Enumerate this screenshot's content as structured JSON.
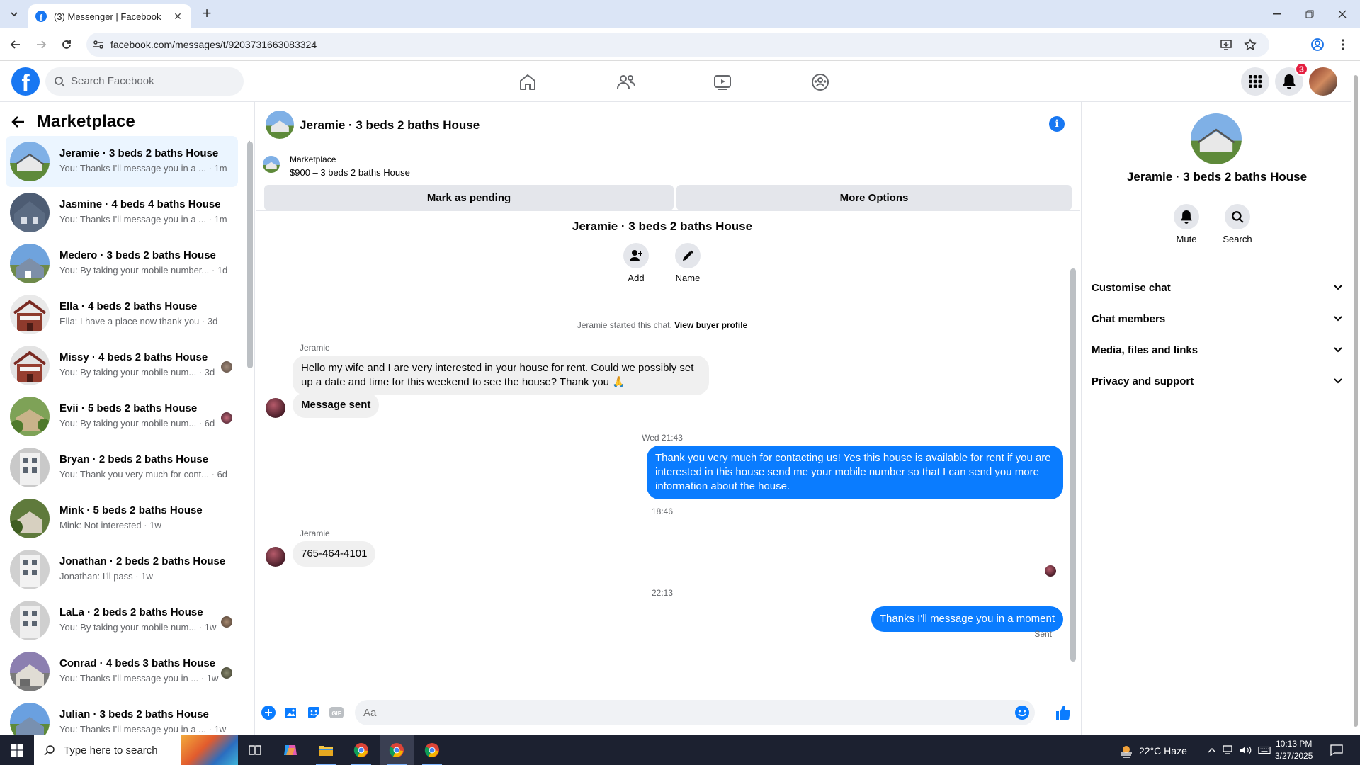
{
  "browser": {
    "tab_title": "(3) Messenger | Facebook",
    "url": "facebook.com/messages/t/9203731663083324"
  },
  "fb": {
    "search_placeholder": "Search Facebook",
    "notification_count": "3",
    "brand_color": "#1877f2"
  },
  "sidebar": {
    "title": "Marketplace",
    "conversations": [
      {
        "name": "Jeramie · 3 beds 2 baths House",
        "preview": "You: Thanks I'll message you in a ...",
        "time": "· 1m",
        "active": true
      },
      {
        "name": "Jasmine · 4 beds 4 baths House",
        "preview": "You: Thanks I'll message you in a ...",
        "time": "· 1m"
      },
      {
        "name": "Medero · 3 beds 2 baths House",
        "preview": "You: By taking your mobile number...",
        "time": "· 1d"
      },
      {
        "name": "Ella · 4 beds 2 baths House",
        "preview": "Ella: I have a place now thank you",
        "time": "· 3d"
      },
      {
        "name": "Missy · 4 beds 2 baths House",
        "preview": "You: By taking your mobile num...",
        "time": "· 3d"
      },
      {
        "name": "Evii · 5 beds 2 baths House",
        "preview": "You: By taking your mobile num...",
        "time": "· 6d"
      },
      {
        "name": "Bryan · 2 beds 2 baths House",
        "preview": "You: Thank you very much for cont...",
        "time": "· 6d"
      },
      {
        "name": "Mink · 5 beds 2 baths House",
        "preview": "Mink: Not interested",
        "time": "· 1w"
      },
      {
        "name": "Jonathan · 2 beds 2 baths House",
        "preview": "Jonathan: I'll pass",
        "time": "· 1w"
      },
      {
        "name": "LaLa · 2 beds 2 baths House",
        "preview": "You: By taking your mobile num...",
        "time": "· 1w"
      },
      {
        "name": "Conrad · 4 beds 3 baths House",
        "preview": "You: Thanks I'll message you in ...",
        "time": "· 1w"
      },
      {
        "name": "Julian · 3 beds 2 baths House",
        "preview": "You: Thanks I'll message you in a ...",
        "time": "· 1w"
      }
    ]
  },
  "chat": {
    "title": "Jeramie · 3 beds 2 baths House",
    "marketplace_label": "Marketplace",
    "listing": "$900 – 3 beds 2 baths House",
    "mark_pending": "Mark as pending",
    "more_options": "More Options",
    "intro_title": "Jeramie · 3 beds 2 baths House",
    "add_label": "Add",
    "name_label": "Name",
    "started_note": "Jeramie started this chat.",
    "view_profile": "View buyer profile",
    "messages": [
      {
        "sender": "Jeramie",
        "text": "Hello my wife and I are very interested in your house for rent. Could we possibly set up a date and time for this weekend to see the house? Thank you 🙏"
      },
      {
        "text": "Message sent"
      },
      {
        "time": "Wed 21:43"
      },
      {
        "text": "Thank you very much for contacting us! Yes this house is available for rent if you are interested in this house send me your mobile number so that I can send you more information about the house."
      },
      {
        "time": "18:46"
      },
      {
        "sender": "Jeramie",
        "text": "765-464-4101"
      },
      {
        "time": "22:13"
      },
      {
        "text": "Thanks I'll message you in a moment"
      }
    ],
    "sent_status": "Sent",
    "composer_placeholder": "Aa"
  },
  "rpanel": {
    "name": "Jeramie · 3 beds 2 baths House",
    "mute": "Mute",
    "search": "Search",
    "sections": [
      "Customise chat",
      "Chat members",
      "Media, files and links",
      "Privacy and support"
    ]
  },
  "taskbar": {
    "search_placeholder": "Type here to search",
    "weather": "22°C  Haze",
    "time": "10:13 PM",
    "date": "3/27/2025"
  }
}
